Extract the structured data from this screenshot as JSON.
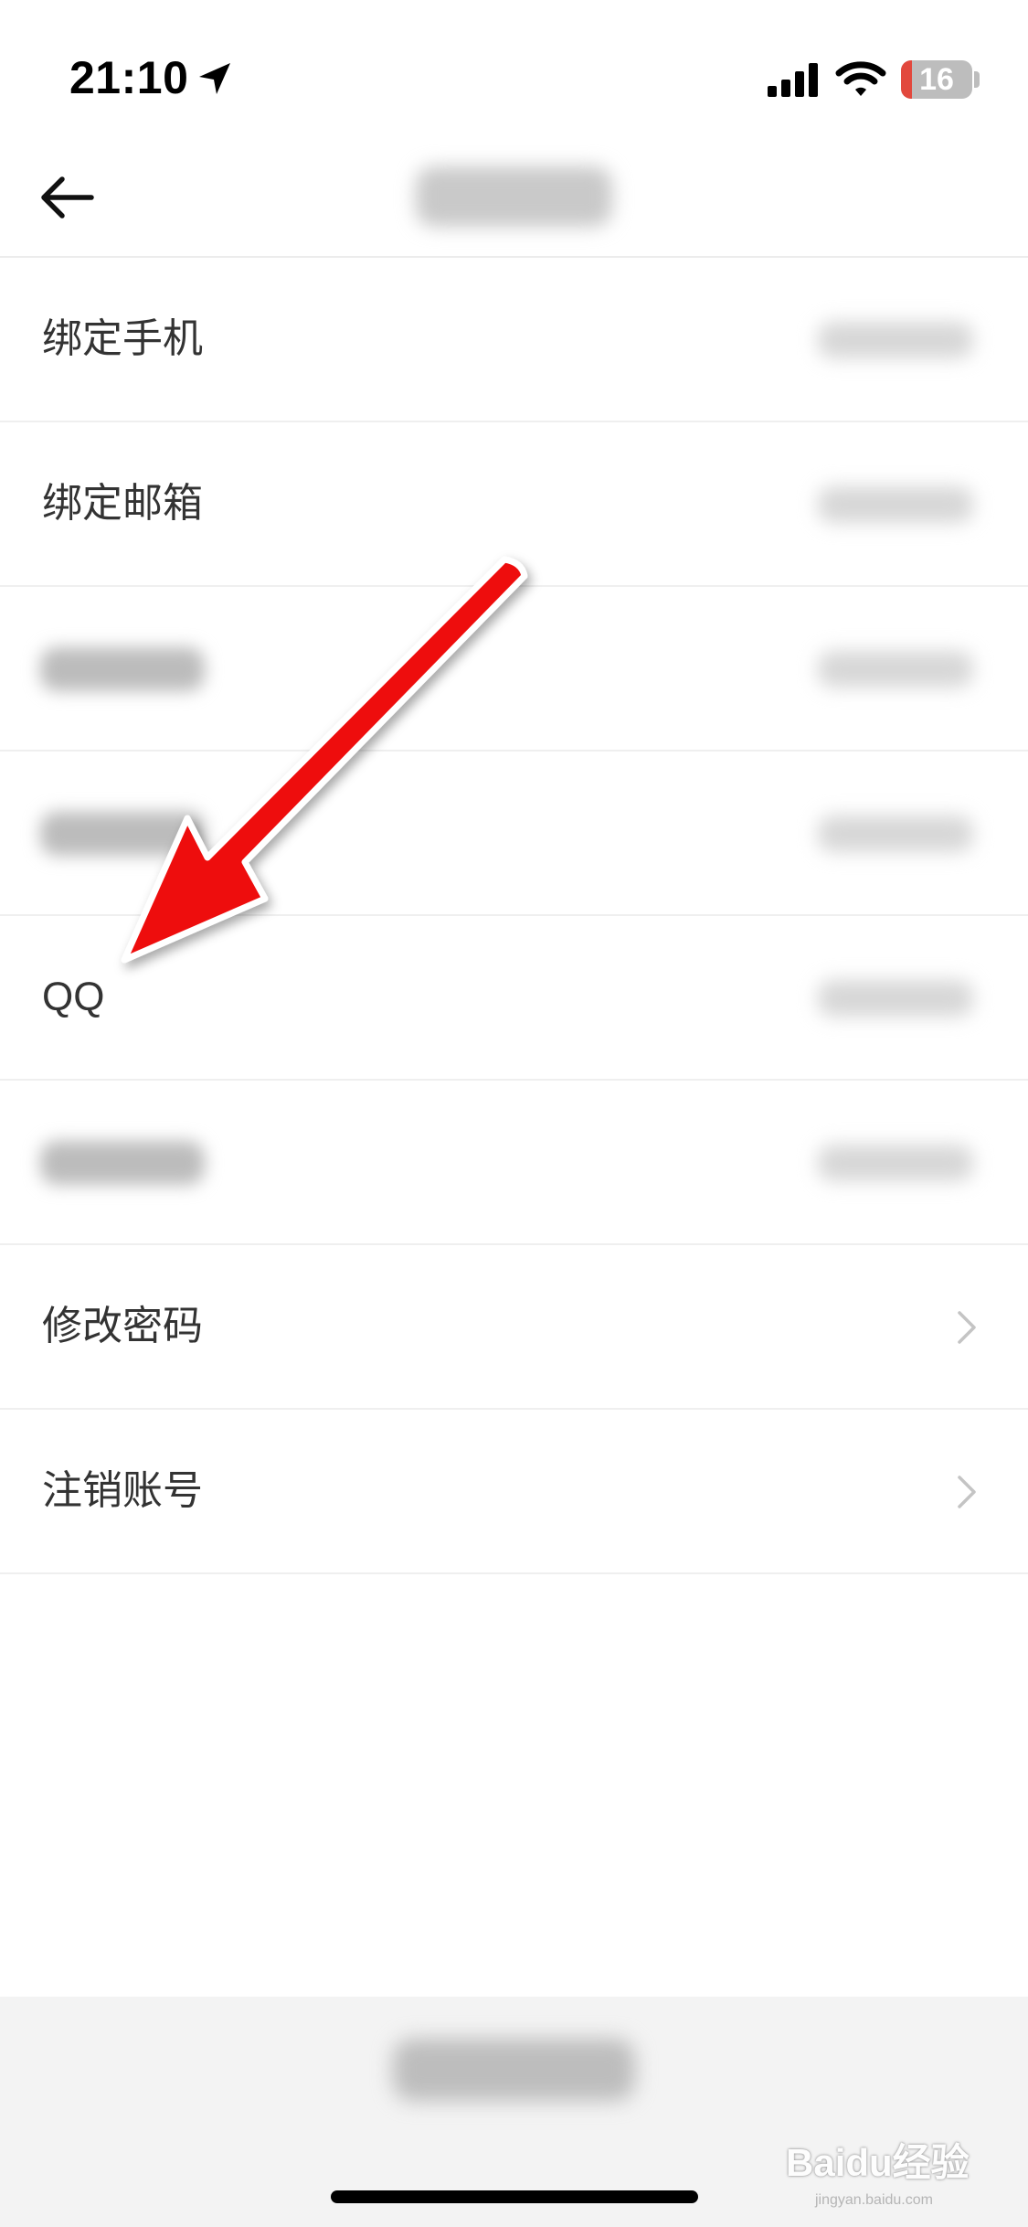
{
  "status_bar": {
    "time": "21:10",
    "battery": "16",
    "battery_level": 0.16,
    "icons": [
      "location-arrow-icon",
      "cellular-signal-icon",
      "wifi-icon",
      "battery-icon"
    ]
  },
  "nav": {
    "back_icon": "back-arrow-icon"
  },
  "rows": [
    {
      "label": "绑定手机"
    },
    {
      "label": "绑定邮箱"
    },
    {
      "label": ""
    },
    {
      "label": ""
    },
    {
      "label": "QQ"
    },
    {
      "label": ""
    },
    {
      "label": "修改密码"
    },
    {
      "label": "注销账号"
    }
  ],
  "watermark": {
    "logo": "Baidu经验",
    "url": "jingyan.baidu.com"
  },
  "colors": {
    "annotation_arrow": "#ee1111",
    "battery_low": "#e2483d",
    "divider": "#efefef",
    "bottom_bar": "#f3f3f3"
  }
}
